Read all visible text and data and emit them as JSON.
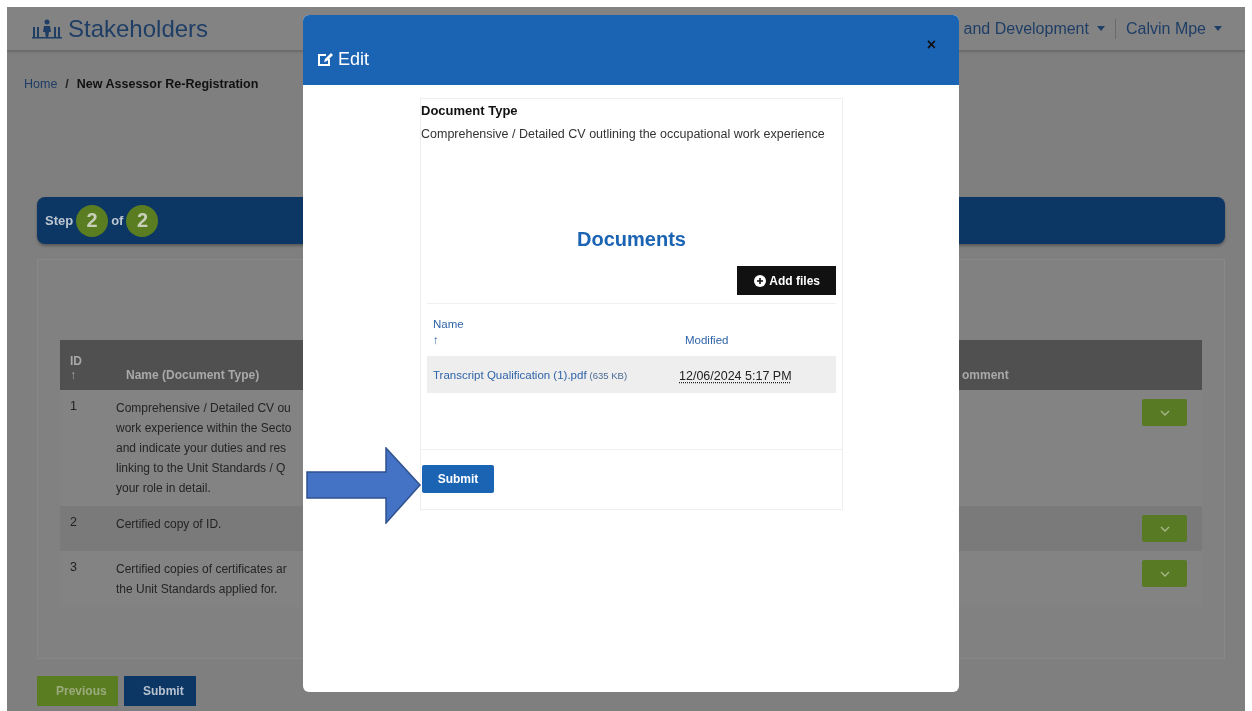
{
  "header": {
    "brand": "Stakeholders",
    "menus": [
      {
        "label": "and Development"
      },
      {
        "label": "Calvin Mpe"
      }
    ]
  },
  "breadcrumb": {
    "separator": "/",
    "items": [
      {
        "label": "Home",
        "current": false
      },
      {
        "label": "New Assessor Re-Registration",
        "current": true
      }
    ]
  },
  "stepper": {
    "step_word": "Step",
    "current": "2",
    "of_word": "of",
    "total": "2"
  },
  "table": {
    "columns": [
      {
        "label": "ID",
        "sort_icon": "↑"
      },
      {
        "label": "Name (Document Type)"
      },
      {
        "label": "omment"
      }
    ],
    "rows": [
      {
        "id": "1",
        "name_lines": [
          "Comprehensive / Detailed CV ou",
          "work experience within the Secto",
          "and indicate your duties and res",
          "linking to the Unit Standards / Q",
          "your role in detail."
        ]
      },
      {
        "id": "2",
        "name_lines": [
          "Certified copy of ID."
        ]
      },
      {
        "id": "3",
        "name_lines": [
          "Certified copies of certificates ar",
          "the Unit Standards applied for."
        ]
      }
    ]
  },
  "footer_buttons": [
    {
      "label": "Previous",
      "kind": "secondary"
    },
    {
      "label": "Submit",
      "kind": "primary"
    }
  ],
  "modal": {
    "title": "Edit",
    "close": "×",
    "document_type_label": "Document Type",
    "document_type_value": "Comprehensive / Detailed CV outlining the occupational work experience",
    "documents_heading": "Documents",
    "add_files": "Add files",
    "columns": [
      {
        "label": "Name",
        "sort_icon": "↑"
      },
      {
        "label": "Modified"
      }
    ],
    "files": [
      {
        "name": "Transcript Qualification (1).pdf",
        "size": "(635 KB)",
        "modified": "12/06/2024 5:17 PM"
      }
    ],
    "submit": "Submit"
  }
}
